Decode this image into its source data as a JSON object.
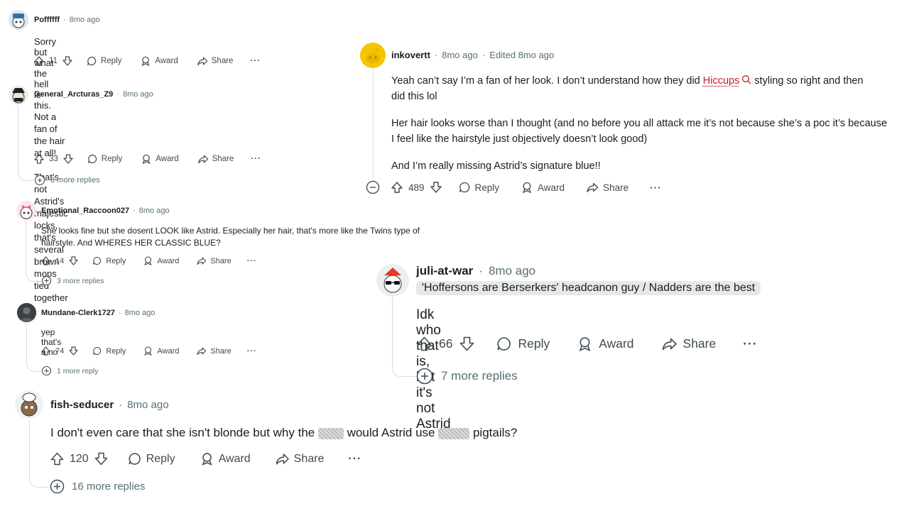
{
  "colors": {
    "text": "#1c1c1c",
    "meta": "#576f76",
    "action": "#3e4a52",
    "link": "#c0202a",
    "line": "#d8dde0",
    "flair_bg": "#e6e8ea"
  },
  "comments": [
    {
      "user": "Poffffff",
      "time": "8mo ago",
      "body": [
        "Sorry but what the hell is this."
      ],
      "votes": "11",
      "reply": "Reply",
      "award": "Award",
      "share": "Share",
      "more": "",
      "avatar": "snoo-blue-hat-icon"
    },
    {
      "user": "General_Arcturas_Z9",
      "time": "8mo ago",
      "body": [
        "Not a fan of the hair at all!",
        "That's not Astrid's majestic locks, that's several brown mops tied together"
      ],
      "votes": "33",
      "reply": "Reply",
      "award": "Award",
      "share": "Share",
      "more": "8 more replies",
      "avatar": "snoo-black-hat-icon"
    },
    {
      "user": "Emotional_Raccoon027",
      "time": "8mo ago",
      "body": [
        "She looks fine but she dosent LOOK like Astrid. Especially her hair, that's more like the Twins type of hairstyle. And WHERES HER CLASSIC BLUE?"
      ],
      "votes": "14",
      "reply": "Reply",
      "award": "Award",
      "share": "Share",
      "more": "3 more replies",
      "avatar": "snoo-pink-bow-icon"
    },
    {
      "user": "Mundane-Clerk1727",
      "time": "8mo ago",
      "body": [
        "yep that's a no"
      ],
      "votes": "74",
      "reply": "Reply",
      "award": "Award",
      "share": "Share",
      "more": "1 more reply",
      "avatar": "photo-avatar-icon"
    },
    {
      "user": "fish-seducer",
      "time": "8mo ago",
      "body_parts": [
        "I don't even care that she isn't blonde but why the",
        "would Astrid use",
        "pigtails?"
      ],
      "votes": "120",
      "reply": "Reply",
      "award": "Award",
      "share": "Share",
      "more": "16 more replies",
      "avatar": "snoo-chef-icon"
    },
    {
      "user": "inkovertt",
      "time": "8mo ago",
      "edited": "Edited 8mo ago",
      "body_line1_pre": "Yeah can’t say I’m a fan of her look. I don’t understand how they did",
      "body_link": "Hiccups",
      "body_line1_post": "styling so right and then",
      "body_line1_cont": "did this lol",
      "body_p2": "Her hair looks worse than I thought (and no before you all attack me it’s not because she’s a poc it’s because I feel like the hairstyle just objectively doesn’t look good)",
      "body_p3": "And I’m really missing Astrid’s signature blue!!",
      "votes": "489",
      "reply": "Reply",
      "award": "Award",
      "share": "Share",
      "avatar": "snoo-default-yellow-icon"
    },
    {
      "user": "juli-at-war",
      "time": "8mo ago",
      "flair": "'Hoffersons are Berserkers' headcanon guy / Nadders are the best",
      "body": [
        "Idk who that is, but it's not Astrid"
      ],
      "votes": "66",
      "reply": "Reply",
      "award": "Award",
      "share": "Share",
      "more": "7 more replies",
      "avatar": "snoo-sunglasses-icon"
    }
  ]
}
